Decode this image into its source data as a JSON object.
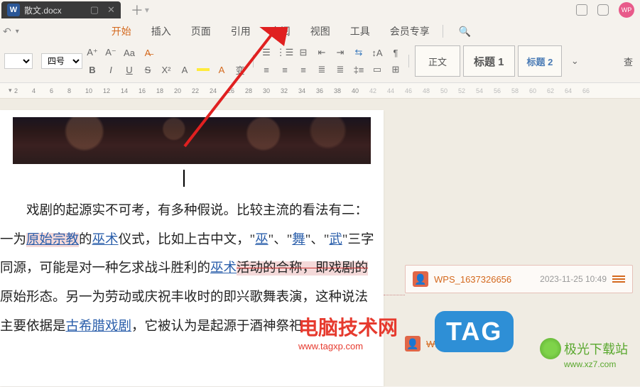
{
  "tab": {
    "icon": "W",
    "title": "散文.docx"
  },
  "menu": {
    "items": [
      "开始",
      "插入",
      "页面",
      "引用",
      "审阅",
      "视图",
      "工具",
      "会员专享"
    ],
    "active_index": 0
  },
  "toolbar": {
    "font_size_label": "四号",
    "bold": "B",
    "italic": "I",
    "underline": "U",
    "strike": "S",
    "super": "A",
    "sub": "A",
    "clear": "A",
    "a_up": "A",
    "a_down": "A",
    "a_color": "A"
  },
  "styles": {
    "normal": "正文",
    "h1": "标题 1",
    "h2": "标题 2",
    "find": "查"
  },
  "ruler": [
    2,
    4,
    6,
    8,
    10,
    12,
    14,
    16,
    18,
    20,
    22,
    24,
    26,
    28,
    30,
    32,
    34,
    36,
    38,
    40,
    42,
    44,
    46,
    48,
    50,
    52,
    54,
    56,
    58,
    60,
    62,
    64,
    66
  ],
  "doc": {
    "p1_a": "戏剧的起源实不可考，有多种假说。比较主流的看法有二：",
    "p2_a": "一为",
    "p2_rev": "原始宗教",
    "p2_b": "的",
    "p2_link1": "巫术",
    "p2_c": "仪式，比如上古中文，\"",
    "p2_link2": "巫",
    "p2_d": "\"、\"",
    "p2_link3": "舞",
    "p2_e": "\"、\"",
    "p2_link4": "武",
    "p2_f": "\"三字",
    "p3_a": "同源，可能是对一种乞求战斗胜利的",
    "p3_link1": "巫术",
    "p3_b": "活动的合称，即戏剧的",
    "p4_a": "原始形态。另一为劳动或庆祝丰收时的即兴歌舞表演，这种说法",
    "p5_a": "主要依据是",
    "p5_link1": "古希腊戏剧",
    "p5_b": "，它被认为是起源于酒神祭祀"
  },
  "comments": {
    "c1": {
      "user": "WPS_1637326656",
      "time": "2023-11-25 10:49"
    },
    "c2": {
      "user": "WPS_1637326656"
    }
  },
  "watermark": {
    "site1": "电脑技术网",
    "site1_url": "www.tagxp.com",
    "tag": "TAG",
    "site2": "极光下载站",
    "site2_url": "www.xz7.com"
  }
}
